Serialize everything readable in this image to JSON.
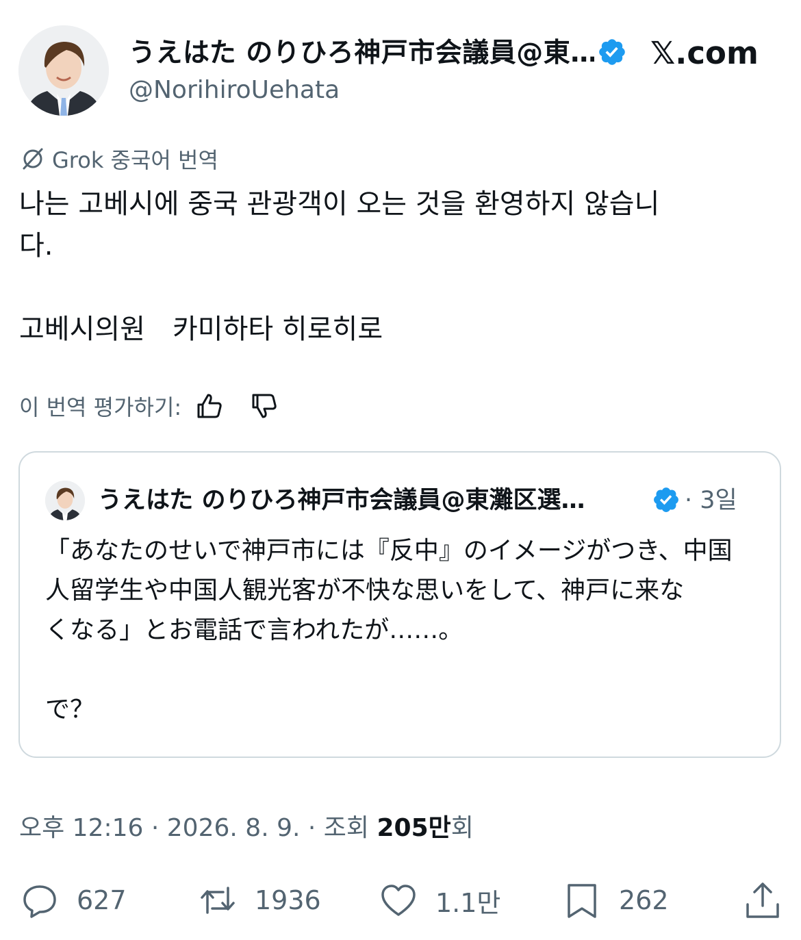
{
  "header": {
    "display_name": "うえはた のりひろ神戸市会議員@東…",
    "handle": "@NorihiroUehata",
    "brand": "𝕏.com"
  },
  "translation": {
    "label": "Grok 중국어 번역",
    "body": "나는 고베시에 중국 관광객이 오는 것을 환영하지 않습니\n다.\n\n고베시의원　카미하타 히로히로",
    "rate_label": "이 번역 평가하기:"
  },
  "quote": {
    "display_name": "うえはた のりひろ神戸市会議員@東灘区選…",
    "time": "· 3일",
    "text": "「あなたのせいで神戸市には『反中』のイメージがつき、中国\n人留学生や中国人観光客が不快な思いをして、神戸に来な\nくなる」とお電話で言われたが……。\n\nで？"
  },
  "meta": {
    "time": "오후 12:16",
    "date": "2026. 8. 9.",
    "views_prefix": "조회",
    "views_count": "205만",
    "views_suffix": "회"
  },
  "actions": {
    "replies": "627",
    "reposts": "1936",
    "likes": "1.1만",
    "bookmarks": "262"
  },
  "colors": {
    "verified": "#1d9bf0",
    "text_primary": "#0f1419",
    "text_secondary": "#536471",
    "border": "#cfd9de"
  },
  "icons": [
    "grok-icon",
    "verified-badge-icon",
    "thumbs-up-icon",
    "thumbs-down-icon",
    "reply-icon",
    "repost-icon",
    "like-icon",
    "bookmark-icon",
    "share-icon"
  ]
}
